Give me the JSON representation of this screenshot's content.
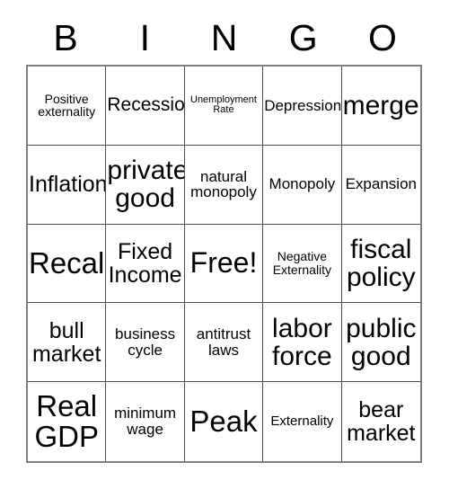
{
  "card": {
    "title": "BINGO",
    "header_letters": [
      "B",
      "I",
      "N",
      "G",
      "O"
    ],
    "rows": 5,
    "columns": 5,
    "free_space": "Free!",
    "colors": {
      "background": "#ffffff",
      "text": "#000000",
      "grid_line": "#4d4d4d",
      "outer_border": "#808080"
    },
    "cells": [
      {
        "text": "Positive\nexternality",
        "size": "fs-sm",
        "free": false
      },
      {
        "text": "Recession",
        "size": "fs-lg",
        "free": false
      },
      {
        "text": "Unemployment\nRate",
        "size": "fs-xs",
        "free": false
      },
      {
        "text": "Depression",
        "size": "fs-md",
        "free": false
      },
      {
        "text": "merger",
        "size": "fs-xxl",
        "free": false
      },
      {
        "text": "Inflation",
        "size": "fs-xl",
        "free": false
      },
      {
        "text": "private\ngood",
        "size": "fs-xxl",
        "free": false
      },
      {
        "text": "natural\nmonopoly",
        "size": "fs-md",
        "free": false
      },
      {
        "text": "Monopoly",
        "size": "fs-md",
        "free": false
      },
      {
        "text": "Expansion",
        "size": "fs-md",
        "free": false
      },
      {
        "text": "Recall",
        "size": "fs-huge",
        "free": false
      },
      {
        "text": "Fixed\nIncome",
        "size": "fs-xl",
        "free": false
      },
      {
        "text": "Free!",
        "size": "fs-huge",
        "free": true
      },
      {
        "text": "Negative\nExternality",
        "size": "fs-sm",
        "free": false
      },
      {
        "text": "fiscal\npolicy",
        "size": "fs-xxl",
        "free": false
      },
      {
        "text": "bull\nmarket",
        "size": "fs-xl",
        "free": false
      },
      {
        "text": "business\ncycle",
        "size": "fs-md",
        "free": false
      },
      {
        "text": "antitrust\nlaws",
        "size": "fs-md",
        "free": false
      },
      {
        "text": "labor\nforce",
        "size": "fs-xxl",
        "free": false
      },
      {
        "text": "public\ngood",
        "size": "fs-xxl",
        "free": false
      },
      {
        "text": "Real\nGDP",
        "size": "fs-huge",
        "free": false
      },
      {
        "text": "minimum\nwage",
        "size": "fs-md",
        "free": false
      },
      {
        "text": "Peak",
        "size": "fs-huge",
        "free": false
      },
      {
        "text": "Externality",
        "size": "fs-smp",
        "free": false
      },
      {
        "text": "bear\nmarket",
        "size": "fs-xl",
        "free": false
      }
    ]
  }
}
